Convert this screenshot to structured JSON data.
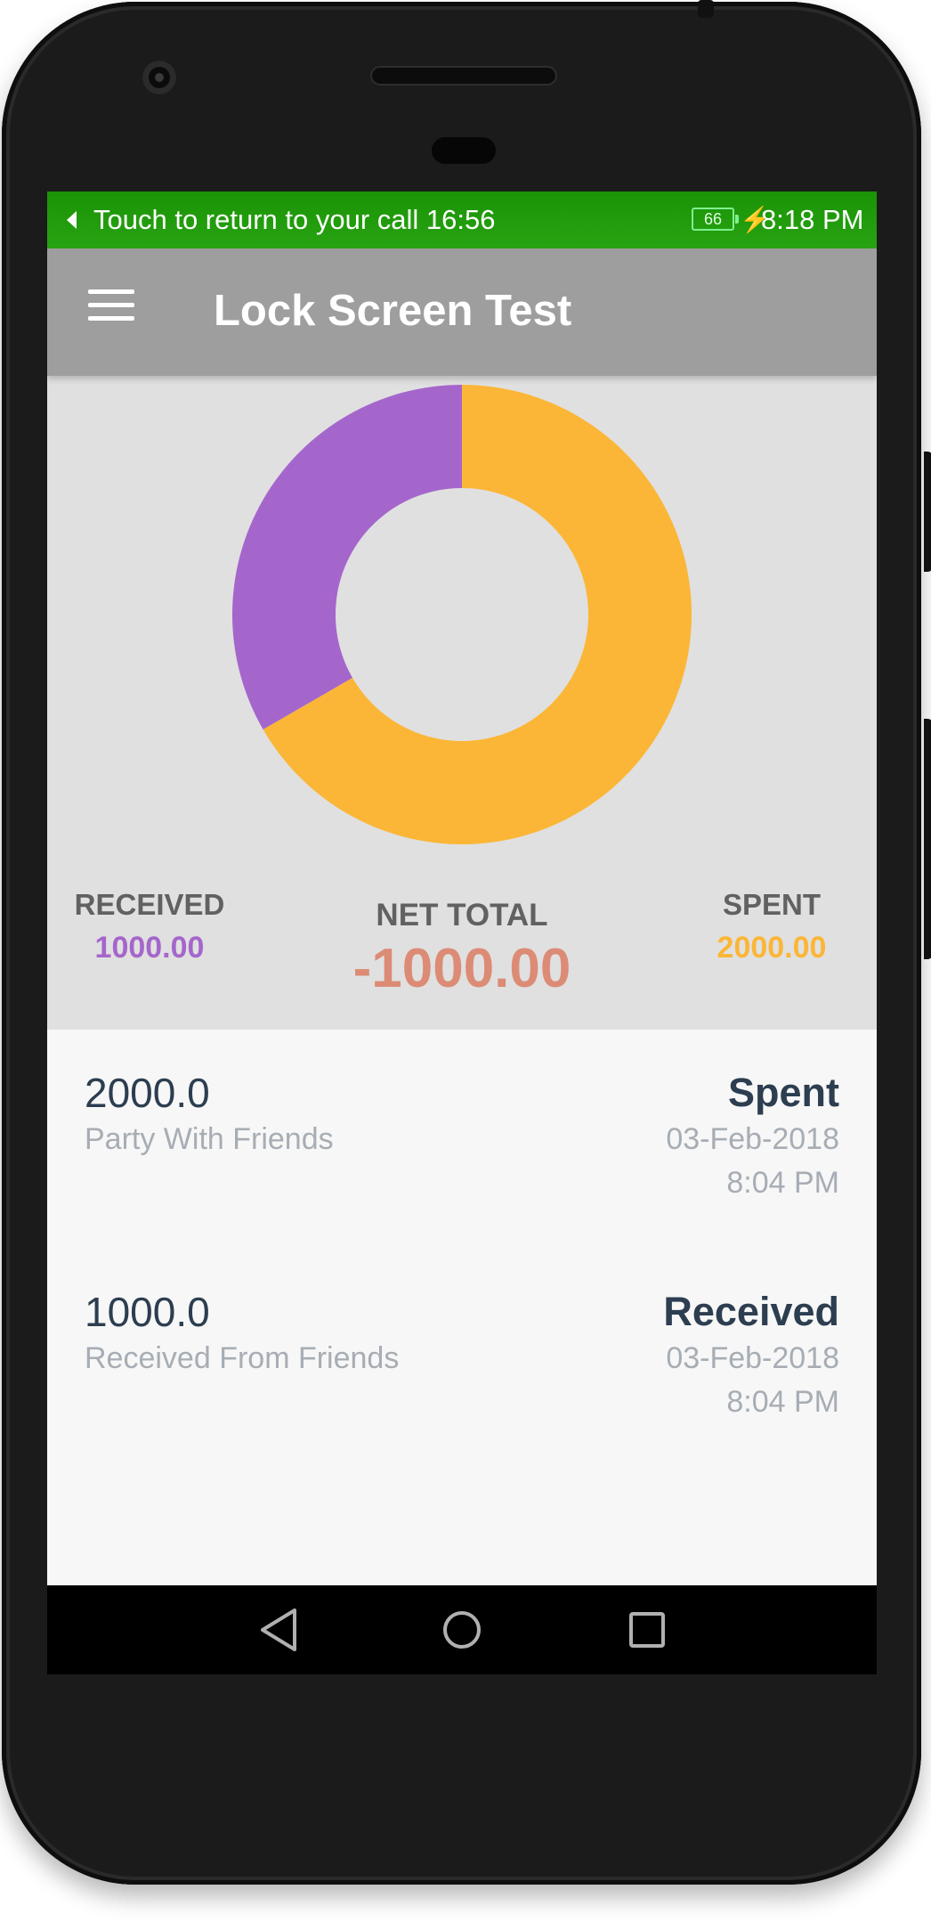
{
  "status_bar": {
    "call_text": "Touch to return to your call 16:56",
    "battery_level": "66",
    "time": "8:18 PM"
  },
  "app_bar": {
    "title": "Lock Screen Test",
    "menu_icon": "hamburger-menu-icon"
  },
  "chart_data": {
    "type": "pie",
    "style": "donut",
    "categories": [
      "Received",
      "Spent"
    ],
    "values": [
      1000,
      2000
    ],
    "colors": [
      "#a566cc",
      "#fbb637"
    ]
  },
  "summary": {
    "received_label": "RECEIVED",
    "received_value": "1000.00",
    "net_total_label": "NET TOTAL",
    "net_total_value": "-1000.00",
    "spent_label": "SPENT",
    "spent_value": "2000.00"
  },
  "transactions": [
    {
      "amount": "2000.0",
      "note": "Party With Friends",
      "type": "Spent",
      "date": "03-Feb-2018",
      "time": "8:04 PM"
    },
    {
      "amount": "1000.0",
      "note": "Received From Friends",
      "type": "Received",
      "date": "03-Feb-2018",
      "time": "8:04 PM"
    }
  ],
  "nav_bar": {
    "back_icon": "back-triangle-icon",
    "home_icon": "home-circle-icon",
    "recents_icon": "recents-square-icon"
  },
  "colors": {
    "status_bar": "#1f9a0a",
    "app_bar": "#9e9e9e",
    "received": "#a566cc",
    "spent": "#fbb637",
    "net_total": "#dc8b75"
  }
}
